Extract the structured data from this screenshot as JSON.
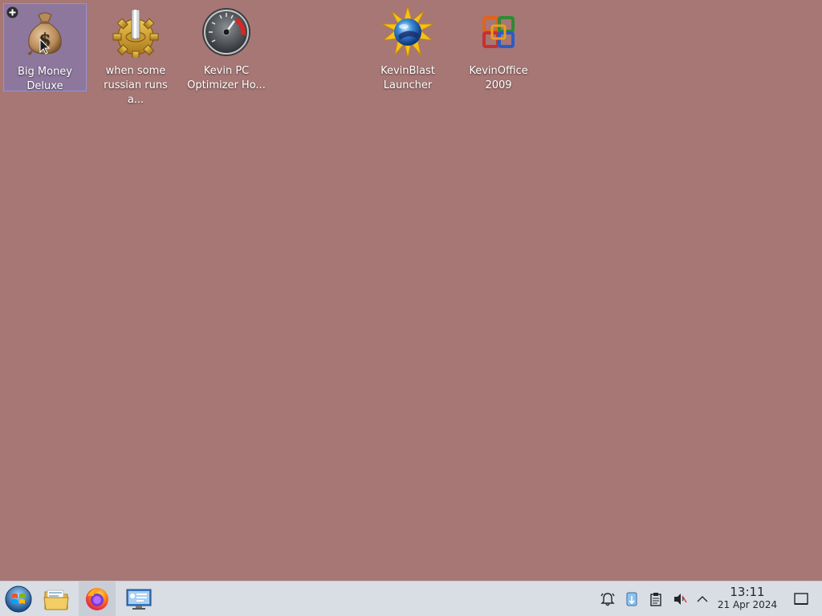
{
  "desktop": {
    "background_color": "#a67775",
    "icons": [
      {
        "label": "Big Money\nDeluxe",
        "icon": "money-bag-icon",
        "selected": true
      },
      {
        "label": "when some\nrussian runs a...",
        "icon": "gear-icon",
        "selected": false
      },
      {
        "label": "Kevin PC\nOptimizer Ho...",
        "icon": "speedometer-icon",
        "selected": false
      },
      {
        "label": "KevinBlast\nLauncher",
        "icon": "blast-globe-icon",
        "selected": false
      },
      {
        "label": "KevinOffice\n2009",
        "icon": "office-logo-icon",
        "selected": false
      }
    ]
  },
  "taskbar": {
    "launchers": [
      {
        "name": "start-menu",
        "icon": "start-orb-icon"
      },
      {
        "name": "file-manager",
        "icon": "folder-icon"
      },
      {
        "name": "firefox",
        "icon": "firefox-icon",
        "active": true
      },
      {
        "name": "system-settings",
        "icon": "settings-panel-icon"
      }
    ],
    "tray": [
      {
        "name": "notifications",
        "icon": "alarm-bell-icon"
      },
      {
        "name": "updates",
        "icon": "update-icon"
      },
      {
        "name": "clipboard",
        "icon": "clipboard-icon"
      },
      {
        "name": "volume",
        "icon": "speaker-muted-icon"
      },
      {
        "name": "expand",
        "icon": "chevron-up-icon"
      }
    ],
    "clock": {
      "time": "13:11",
      "date": "21 Apr 2024"
    },
    "show_desktop_icon": "show-desktop-icon"
  }
}
